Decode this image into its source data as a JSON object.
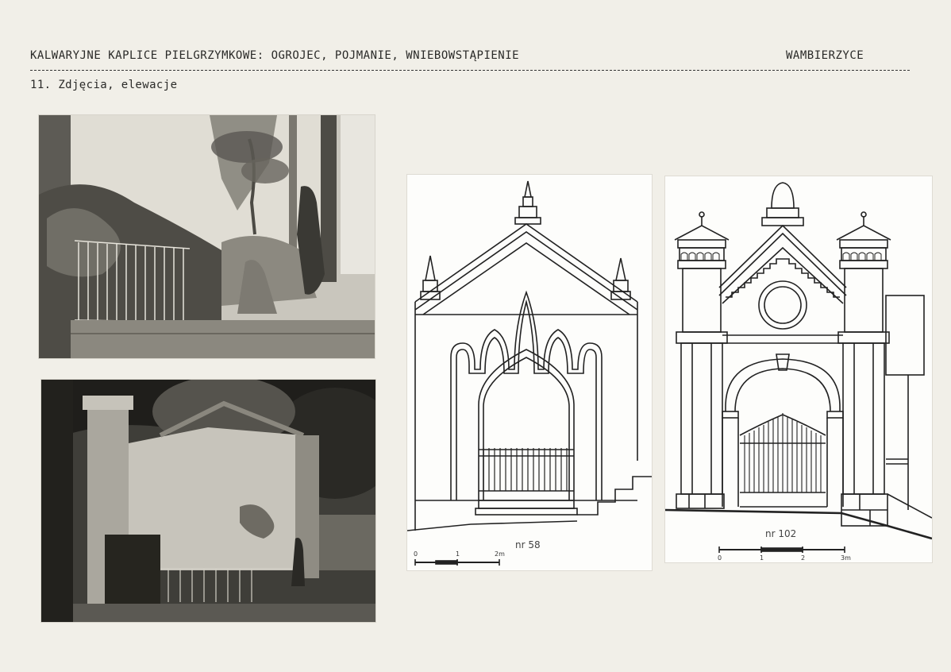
{
  "header": {
    "title": "KALWARYJNE KAPLICE PIELGRZYMKOWE: OGROJEC, POJMANIE, WNIEBOWSTĄPIENIE",
    "location": "WAMBIERZYCE",
    "subtitle": "11. Zdjęcia, elewacje"
  },
  "drawings": [
    {
      "label": "nr 58",
      "scale_labels": [
        "0",
        "1",
        "2m"
      ]
    },
    {
      "label": "nr 102",
      "scale_labels": [
        "0",
        "1",
        "2",
        "3m"
      ]
    }
  ]
}
